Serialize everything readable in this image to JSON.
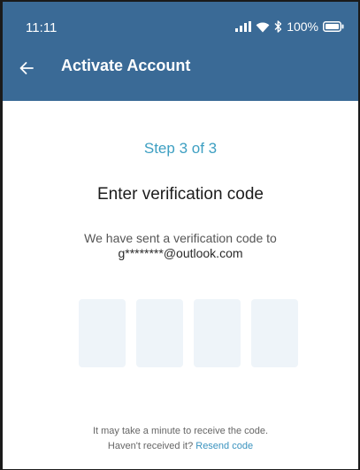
{
  "status_bar": {
    "time": "11:11",
    "battery_percent": "100%",
    "battery_level": 1.0
  },
  "toolbar": {
    "back_icon": "arrow-left-icon",
    "title": "Activate Account"
  },
  "verification": {
    "step": "Step 3 of 3",
    "heading": "Enter verification code",
    "sent_line": "We have sent a verification code to",
    "email": "g********@outlook.com",
    "code_digits": [
      "",
      "",
      "",
      ""
    ]
  },
  "footer": {
    "line1": "It may take a minute to receive the code.",
    "line2_prefix": "Haven't received it?",
    "resend_label": "Resend code"
  },
  "colors": {
    "app_bar": "#3a6a96",
    "step_accent": "#3d9fc2",
    "link": "#3a93bf",
    "code_box_fill": "#eef4f9"
  }
}
